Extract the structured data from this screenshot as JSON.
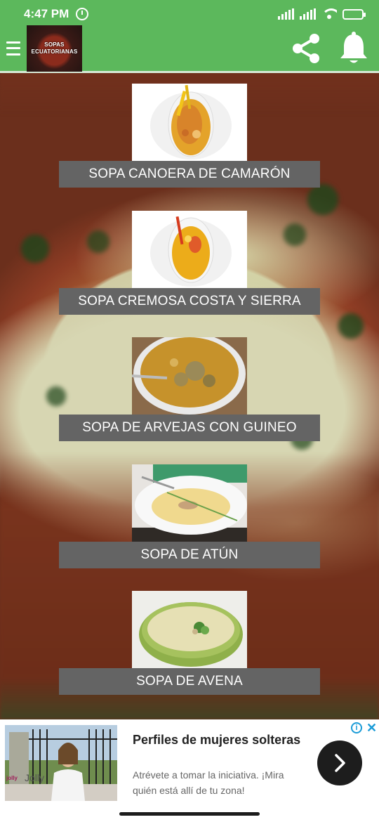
{
  "status_bar": {
    "time": "4:47 PM",
    "battery_level": 0.75
  },
  "app_bar": {
    "logo_text": "SOPAS ECUATORIANAS",
    "accent_color": "#5cb85c"
  },
  "soups": [
    {
      "label": "SOPA CANOERA DE CAMARÓN"
    },
    {
      "label": "SOPA CREMOSA COSTA Y SIERRA"
    },
    {
      "label": "SOPA DE ARVEJAS CON GUINEO"
    },
    {
      "label": "SOPA DE ATÚN"
    },
    {
      "label": "SOPA DE AVENA"
    }
  ],
  "ad": {
    "title": "Perfiles de mujeres solteras",
    "description": "Atrévete a tomar la iniciativa. ¡Mira quién está allí de tu zona!",
    "brand": "Jolly",
    "brand_logo": "jolly"
  },
  "icons": {
    "menu": "menu-icon",
    "share": "share-icon",
    "bell": "bell-icon",
    "next": "chevron-right-icon",
    "info": "info-icon",
    "close": "close-icon"
  }
}
